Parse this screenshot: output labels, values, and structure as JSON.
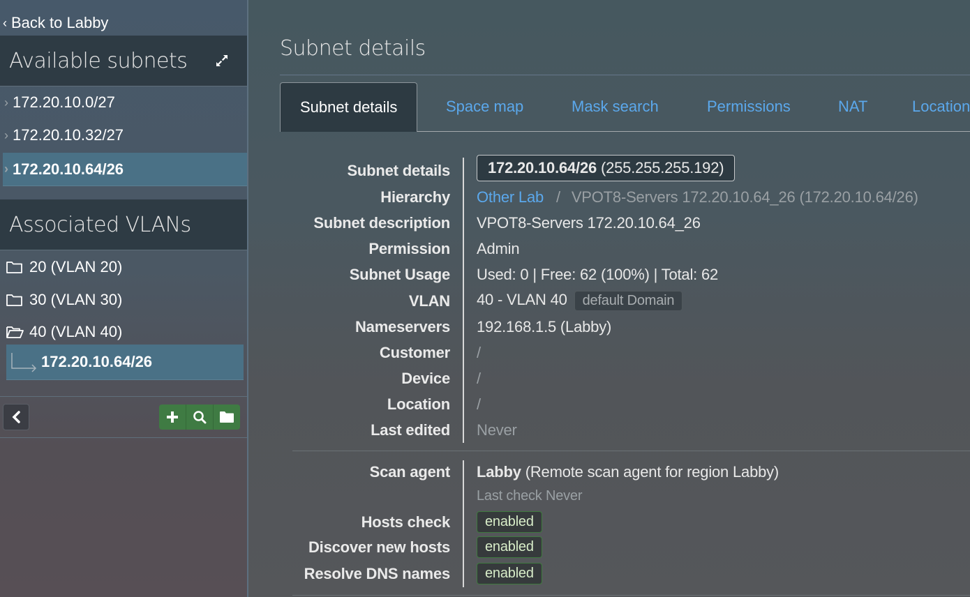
{
  "sidebar": {
    "back_label": "Back to Labby",
    "subnets_title": "Available subnets",
    "subnets": [
      {
        "label": "172.20.10.0/27",
        "active": false
      },
      {
        "label": "172.20.10.32/27",
        "active": false
      },
      {
        "label": "172.20.10.64/26",
        "active": true
      }
    ],
    "vlans_title": "Associated VLANs",
    "vlans": [
      {
        "label": "20 (VLAN 20)",
        "open": false
      },
      {
        "label": "30 (VLAN 30)",
        "open": false
      },
      {
        "label": "40 (VLAN 40)",
        "open": true
      }
    ],
    "vlan_child": "172.20.10.64/26",
    "icons": {
      "expand": "expand-icon",
      "collapse": "chevron-left-icon",
      "add": "plus-icon",
      "search": "search-icon",
      "folder": "folder-icon"
    }
  },
  "main": {
    "title": "Subnet details",
    "tabs": [
      {
        "label": "Subnet details",
        "active": true
      },
      {
        "label": "Space map",
        "active": false
      },
      {
        "label": "Mask search",
        "active": false
      },
      {
        "label": "Permissions",
        "active": false
      },
      {
        "label": "NAT",
        "active": false
      },
      {
        "label": "Location",
        "active": false
      }
    ],
    "details": {
      "subnet_label": "Subnet details",
      "subnet_cidr": "172.20.10.64/26",
      "subnet_mask": "(255.255.255.192)",
      "hierarchy_label": "Hierarchy",
      "hierarchy_link": "Other Lab",
      "hierarchy_sep": "/",
      "hierarchy_current": "VPOT8-Servers 172.20.10.64_26 (172.20.10.64/26)",
      "description_label": "Subnet description",
      "description": "VPOT8-Servers 172.20.10.64_26",
      "permission_label": "Permission",
      "permission": "Admin",
      "usage_label": "Subnet Usage",
      "usage": "Used: 0 | Free: 62 (100%) | Total: 62",
      "vlan_label": "VLAN",
      "vlan": "40 - VLAN 40",
      "vlan_domain": "default Domain",
      "nameservers_label": "Nameservers",
      "nameservers": "192.168.1.5 (Labby)",
      "customer_label": "Customer",
      "customer": "/",
      "device_label": "Device",
      "device": "/",
      "location_label": "Location",
      "location": "/",
      "last_edited_label": "Last edited",
      "last_edited": "Never"
    },
    "scan": {
      "agent_label": "Scan agent",
      "agent_name": "Labby",
      "agent_desc": "(Remote scan agent for region Labby)",
      "last_check": "Last check Never",
      "hosts_check_label": "Hosts check",
      "hosts_check": "enabled",
      "discover_label": "Discover new hosts",
      "discover": "enabled",
      "resolve_label": "Resolve DNS names",
      "resolve": "enabled"
    }
  }
}
